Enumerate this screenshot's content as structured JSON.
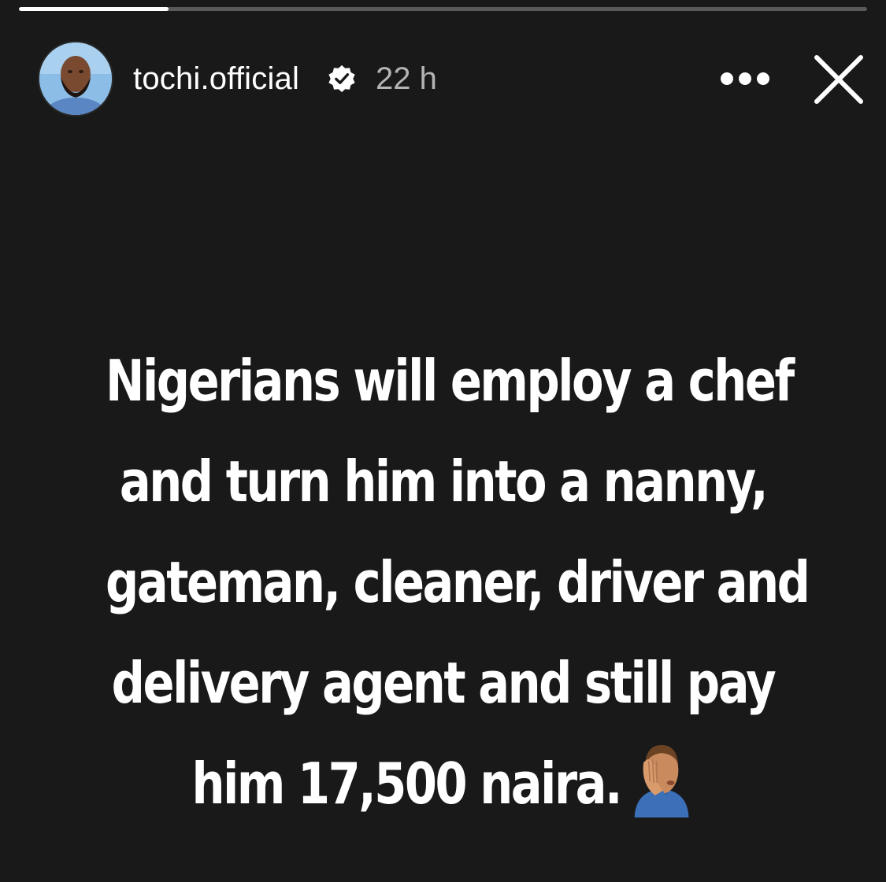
{
  "progress": {
    "fraction": 0.176
  },
  "header": {
    "username": "tochi.official",
    "verified": true,
    "timestamp": "22 h",
    "avatar_icon": "profile-photo",
    "more_icon": "more-dots-icon",
    "close_icon": "close-icon"
  },
  "story": {
    "lines": [
      "Nigerians will employ a chef",
      "and turn him into a nanny,",
      "gateman, cleaner, driver and",
      "delivery agent and still pay",
      "him 17,500 naira."
    ],
    "emoji": "man-facepalming-emoji"
  },
  "colors": {
    "background": "#191919",
    "text": "#ffffff",
    "muted": "#b3b3b3",
    "progress_track": "#5a5a5a"
  }
}
